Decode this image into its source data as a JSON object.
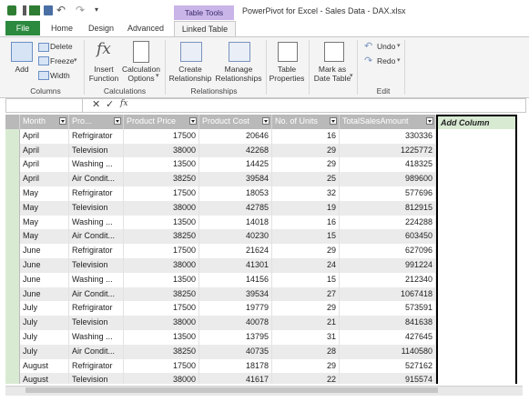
{
  "window": {
    "title": "PowerPivot for Excel - Sales Data - DAX.xlsx",
    "contextual_tab_group": "Table Tools"
  },
  "tabs": [
    "File",
    "Home",
    "Design",
    "Advanced",
    "Linked Table"
  ],
  "active_tab": "Linked Table",
  "ribbon": {
    "columns": {
      "add": "Add",
      "delete": "Delete",
      "freeze": "Freeze",
      "width": "Width",
      "group": "Columns"
    },
    "calculations": {
      "insert_function": [
        "Insert",
        "Function"
      ],
      "calculation_options": [
        "Calculation",
        "Options"
      ],
      "group": "Calculations"
    },
    "relationships": {
      "create": [
        "Create",
        "Relationship"
      ],
      "manage": [
        "Manage",
        "Relationships"
      ],
      "group": "Relationships"
    },
    "table_properties": [
      "Table",
      "Properties"
    ],
    "mark_as_date_table": [
      "Mark as",
      "Date Table"
    ],
    "edit": {
      "undo": "Undo",
      "redo": "Redo",
      "group": "Edit"
    }
  },
  "formula_bar": {
    "fx": "fx",
    "value": ""
  },
  "grid": {
    "headers": [
      "Month",
      "Pro...",
      "Product Price",
      "Product Cost",
      "No. of Units",
      "TotalSalesAmount",
      "Add Column"
    ],
    "rows": [
      [
        "April",
        "Refrigirator",
        "17500",
        "20646",
        "16",
        "330336"
      ],
      [
        "April",
        "Television",
        "38000",
        "42268",
        "29",
        "1225772"
      ],
      [
        "April",
        "Washing ...",
        "13500",
        "14425",
        "29",
        "418325"
      ],
      [
        "April",
        "Air Condit...",
        "38250",
        "39584",
        "25",
        "989600"
      ],
      [
        "May",
        "Refrigirator",
        "17500",
        "18053",
        "32",
        "577696"
      ],
      [
        "May",
        "Television",
        "38000",
        "42785",
        "19",
        "812915"
      ],
      [
        "May",
        "Washing ...",
        "13500",
        "14018",
        "16",
        "224288"
      ],
      [
        "May",
        "Air Condit...",
        "38250",
        "40230",
        "15",
        "603450"
      ],
      [
        "June",
        "Refrigirator",
        "17500",
        "21624",
        "29",
        "627096"
      ],
      [
        "June",
        "Television",
        "38000",
        "41301",
        "24",
        "991224"
      ],
      [
        "June",
        "Washing ...",
        "13500",
        "14156",
        "15",
        "212340"
      ],
      [
        "June",
        "Air Condit...",
        "38250",
        "39534",
        "27",
        "1067418"
      ],
      [
        "July",
        "Refrigirator",
        "17500",
        "19779",
        "29",
        "573591"
      ],
      [
        "July",
        "Television",
        "38000",
        "40078",
        "21",
        "841638"
      ],
      [
        "July",
        "Washing ...",
        "13500",
        "13795",
        "31",
        "427645"
      ],
      [
        "July",
        "Air Condit...",
        "38250",
        "40735",
        "28",
        "1140580"
      ],
      [
        "August",
        "Refrigirator",
        "17500",
        "18178",
        "29",
        "527162"
      ],
      [
        "August",
        "Television",
        "38000",
        "41617",
        "22",
        "915574"
      ]
    ]
  },
  "colors": {
    "file_tab": "#2b8a3e",
    "contextual_tab": "#c9b5e8",
    "header_fill": "#b9b9b9",
    "selected_column_border": "#000000"
  }
}
